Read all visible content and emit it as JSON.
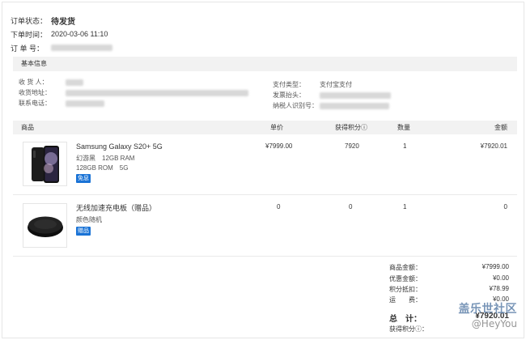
{
  "order": {
    "status_label": "订单状态：",
    "status_value": "待发货",
    "time_label": "下单时间：",
    "time_value": "2020-03-06 11:10",
    "number_label": "订 单 号："
  },
  "basic_info": {
    "title": "基本信息",
    "recipient_label": "收 货 人：",
    "address_label": "收货地址：",
    "phone_label": "联系电话：",
    "pay_type_label": "支付类型：",
    "pay_type_value": "支付宝支付",
    "invoice_label": "发票抬头：",
    "taxpayer_label": "纳税人识别号："
  },
  "table": {
    "headers": {
      "product": "商品",
      "price": "单价",
      "points": "获得积分ⓘ",
      "quantity": "数量",
      "amount": "金额"
    },
    "rows": [
      {
        "name": "Samsung Galaxy S20+ 5G",
        "spec1": "幻游黑　12GB RAM",
        "spec2": "128GB ROM　5G",
        "tag": "免息",
        "tag_color": "#1a73d6",
        "price": "¥7999.00",
        "points": "7920",
        "quantity": "1",
        "amount": "¥7920.01"
      },
      {
        "name": "无线加速充电板（赠品）",
        "spec1": "颜色随机",
        "spec2": "",
        "tag": "赠品",
        "tag_color": "#1a73d6",
        "price": "0",
        "points": "0",
        "quantity": "1",
        "amount": "0"
      }
    ]
  },
  "summary": {
    "goods_label": "商品金额：",
    "goods_value": "¥7999.00",
    "discount_label": "优惠金额：",
    "discount_value": "¥0.00",
    "points_deduct_label": "积分抵扣：",
    "points_deduct_value": "¥78.99",
    "shipping_label": "运　　费：",
    "shipping_value": "¥0.00",
    "total_label": "总　计：",
    "total_value": "¥7920.01",
    "earned_label": "获得积分ⓘ："
  },
  "watermark": {
    "main": "盖乐世社区",
    "sub": "@HeyYou"
  }
}
